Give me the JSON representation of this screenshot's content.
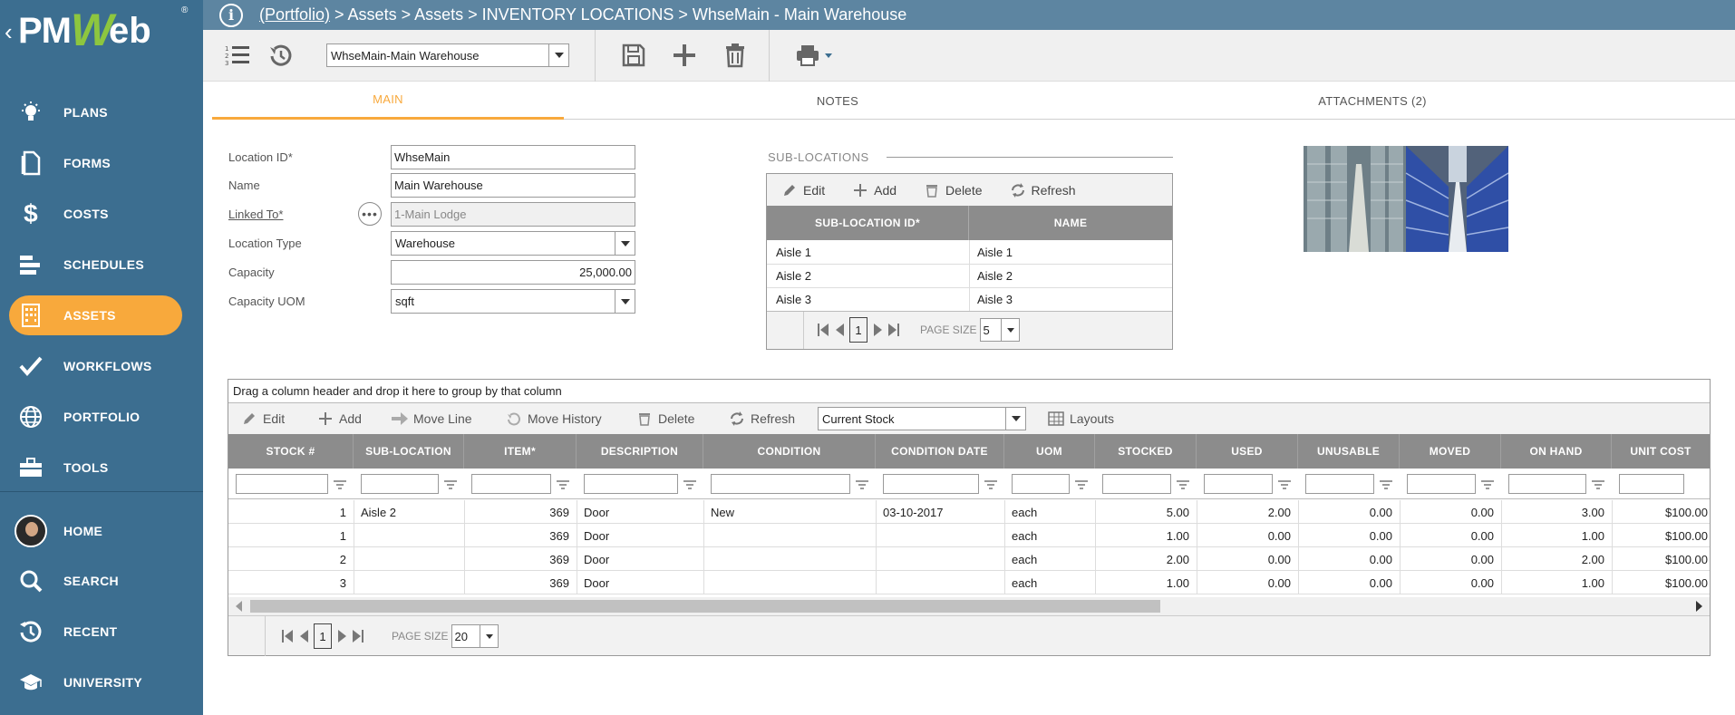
{
  "header": {
    "breadcrumb_link": "(Portfolio)",
    "breadcrumb_rest": " > Assets > Assets > INVENTORY LOCATIONS > WhseMain - Main Warehouse"
  },
  "sidebar": {
    "items": [
      {
        "label": "PLANS",
        "icon": "lightbulb-icon"
      },
      {
        "label": "FORMS",
        "icon": "document-icon"
      },
      {
        "label": "COSTS",
        "icon": "dollar-icon"
      },
      {
        "label": "SCHEDULES",
        "icon": "gantt-icon"
      },
      {
        "label": "ASSETS",
        "icon": "building-icon"
      },
      {
        "label": "WORKFLOWS",
        "icon": "checkmark-icon"
      },
      {
        "label": "PORTFOLIO",
        "icon": "globe-icon"
      },
      {
        "label": "TOOLS",
        "icon": "briefcase-icon"
      },
      {
        "label": "HOME",
        "icon": "avatar"
      },
      {
        "label": "SEARCH",
        "icon": "search-icon"
      },
      {
        "label": "RECENT",
        "icon": "history-icon"
      },
      {
        "label": "UNIVERSITY",
        "icon": "graduation-cap-icon"
      }
    ],
    "active": "ASSETS"
  },
  "toolbar": {
    "record_select": "WhseMain-Main Warehouse"
  },
  "tabs": [
    {
      "label": "MAIN",
      "active": true
    },
    {
      "label": "NOTES",
      "active": false
    },
    {
      "label": "ATTACHMENTS (2)",
      "active": false
    }
  ],
  "form": {
    "location_id_label": "Location ID*",
    "location_id": "WhseMain",
    "name_label": "Name",
    "name": "Main Warehouse",
    "linked_to_label": "Linked To*",
    "linked_to": "1-Main Lodge",
    "location_type_label": "Location Type",
    "location_type": "Warehouse",
    "capacity_label": "Capacity",
    "capacity": "25,000.00",
    "capacity_uom_label": "Capacity UOM",
    "capacity_uom": "sqft"
  },
  "sublocations": {
    "title": "SUB-LOCATIONS",
    "toolbar": {
      "edit": "Edit",
      "add": "Add",
      "delete": "Delete",
      "refresh": "Refresh"
    },
    "columns": [
      "SUB-LOCATION ID*",
      "NAME"
    ],
    "rows": [
      [
        "Aisle 1",
        "Aisle 1"
      ],
      [
        "Aisle 2",
        "Aisle 2"
      ],
      [
        "Aisle 3",
        "Aisle 3"
      ]
    ],
    "page": "1",
    "page_size_label": "PAGE SIZE",
    "page_size": "5"
  },
  "stock": {
    "group_hint": "Drag a column header and drop it here to group by that column",
    "toolbar": {
      "edit": "Edit",
      "add": "Add",
      "move_line": "Move Line",
      "move_history": "Move History",
      "delete": "Delete",
      "refresh": "Refresh",
      "view_select": "Current Stock",
      "layouts": "Layouts"
    },
    "columns": [
      "STOCK #",
      "SUB-LOCATION",
      "ITEM*",
      "DESCRIPTION",
      "CONDITION",
      "CONDITION DATE",
      "UOM",
      "STOCKED",
      "USED",
      "UNUSABLE",
      "MOVED",
      "ON HAND",
      "UNIT COST"
    ],
    "rows": [
      [
        "1",
        "Aisle 2",
        "369",
        "Door",
        "New",
        "03-10-2017",
        "each",
        "5.00",
        "2.00",
        "0.00",
        "0.00",
        "3.00",
        "$100.00"
      ],
      [
        "1",
        "",
        "369",
        "Door",
        "",
        "",
        "each",
        "1.00",
        "0.00",
        "0.00",
        "0.00",
        "1.00",
        "$100.00"
      ],
      [
        "2",
        "",
        "369",
        "Door",
        "",
        "",
        "each",
        "2.00",
        "0.00",
        "0.00",
        "0.00",
        "2.00",
        "$100.00"
      ],
      [
        "3",
        "",
        "369",
        "Door",
        "",
        "",
        "each",
        "1.00",
        "0.00",
        "0.00",
        "0.00",
        "1.00",
        "$100.00"
      ]
    ],
    "page": "1",
    "page_size_label": "PAGE SIZE",
    "page_size": "20"
  },
  "colors": {
    "sidebar": "#3c6e90",
    "header": "#5d85a1",
    "accent": "#f8a93c",
    "grid_header": "#8c8c8c"
  }
}
